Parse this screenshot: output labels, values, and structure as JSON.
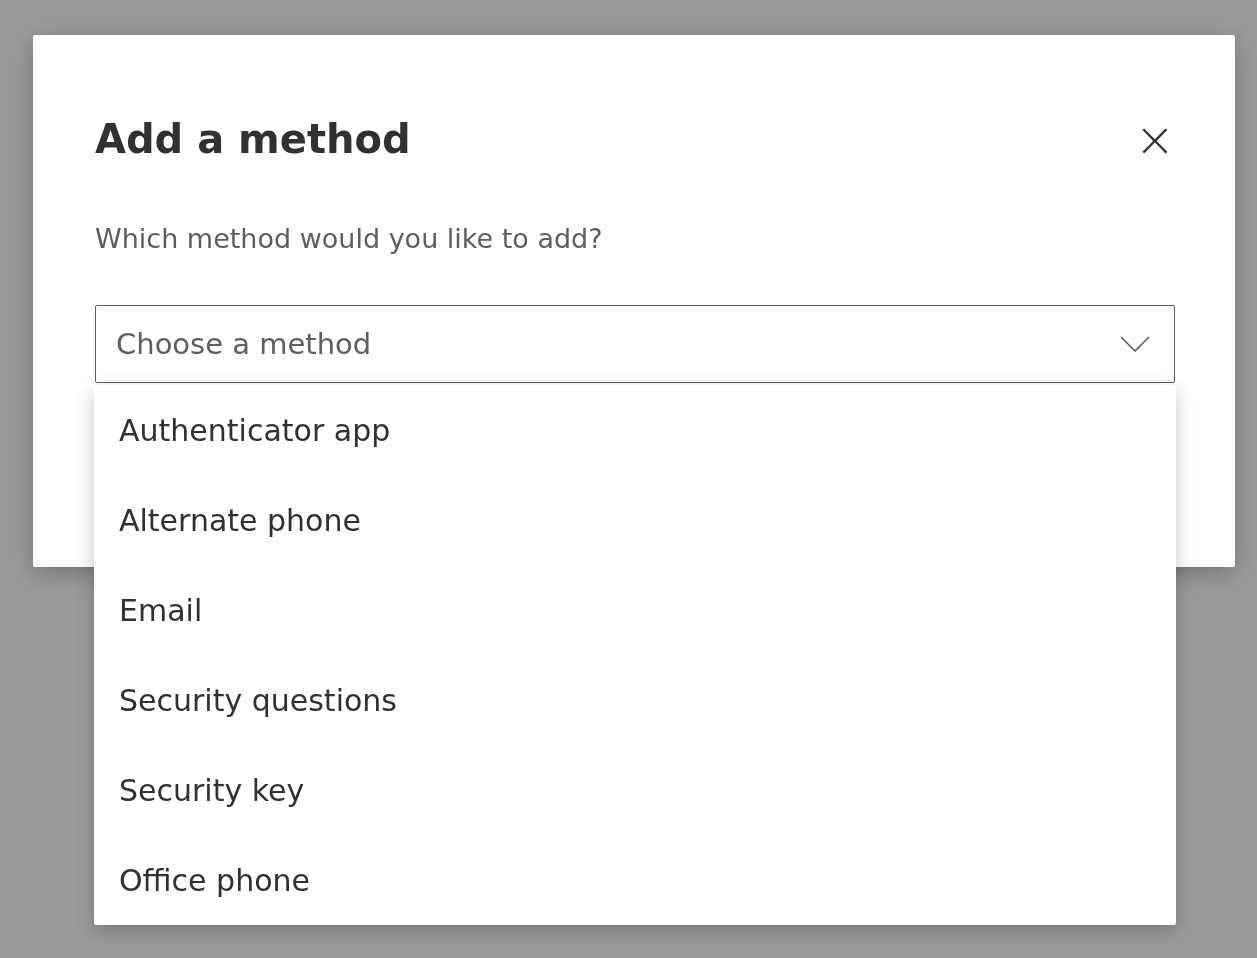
{
  "dialog": {
    "title": "Add a method",
    "close": "×",
    "prompt": "Which method would you like to add?",
    "select": {
      "placeholder": "Choose a method",
      "expanded": true,
      "options": [
        {
          "label": "Authenticator app",
          "selected": false
        },
        {
          "label": "Alternate phone",
          "selected": false
        },
        {
          "label": "Email",
          "selected": false
        },
        {
          "label": "Security questions",
          "selected": false
        },
        {
          "label": "Security key",
          "selected": false
        },
        {
          "label": "Office phone",
          "selected": false
        }
      ]
    }
  }
}
